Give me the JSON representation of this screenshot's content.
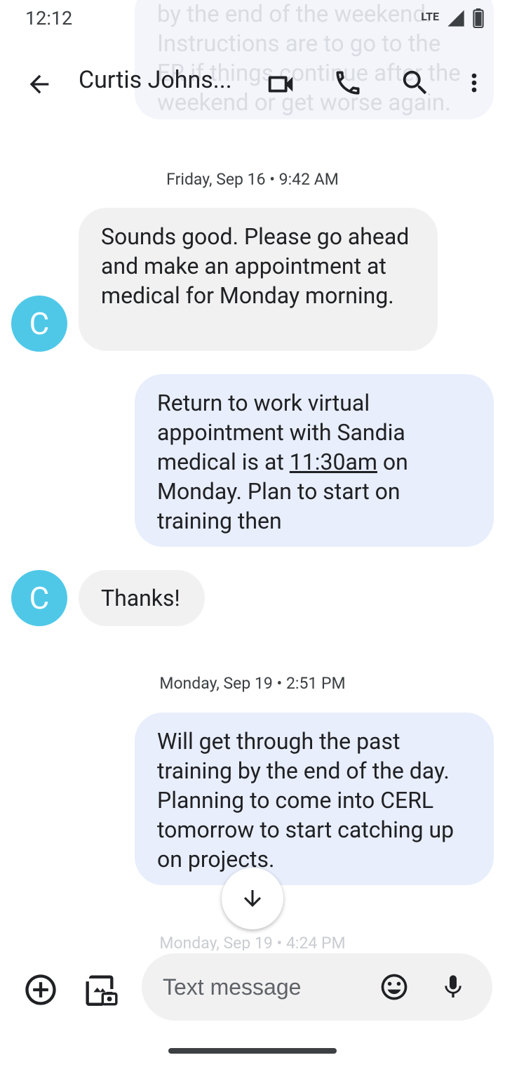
{
  "status_bar": {
    "time": "12:12",
    "network": "LTE"
  },
  "background_overlay": {
    "text": "by the end of the weekend. Instructions are to go to the ER if things continue after the weekend or get worse again."
  },
  "app_bar": {
    "title": "Curtis Johns...",
    "icons": [
      "back-arrow-icon",
      "video-call-icon",
      "phone-icon",
      "search-icon",
      "more-vert-icon"
    ]
  },
  "conversation": {
    "timestamp_1": "Friday, Sep 16 • 9:42 AM",
    "msg_1": {
      "avatar_letter": "C",
      "text": "Sounds good. Please go ahead and make an appointment at medical for Monday morning."
    },
    "msg_2": {
      "text_before": "Return to work virtual appointment with Sandia medical is at ",
      "link": "11:30am",
      "text_after": " on Monday. Plan to start on training then"
    },
    "msg_3": {
      "avatar_letter": "C",
      "text": "Thanks!"
    },
    "timestamp_2": "Monday, Sep 19 • 2:51 PM",
    "msg_4": {
      "text": "Will get through the past training by the end of the day. Planning to come into CERL tomorrow to start catching up on projects."
    },
    "timestamp_3_partial": "Monday, Sep 19 • 4:24 PM"
  },
  "compose": {
    "placeholder": "Text message"
  },
  "colors": {
    "incoming_bubble": "#f1f1f1",
    "outgoing_bubble": "#e8eefb",
    "avatar": "#4fc8e8"
  }
}
